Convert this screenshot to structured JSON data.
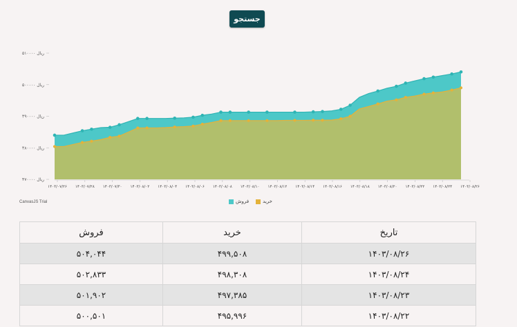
{
  "toolbar": {
    "search_label": "جستجو"
  },
  "colors": {
    "sell": "#4dc8c8",
    "sell_line": "#2fb4b4",
    "buy": "#b1bf6c",
    "buy_line": "#e4b23a"
  },
  "chart_data": {
    "type": "area",
    "title": "",
    "xlabel": "",
    "ylabel": "",
    "ylim": [
      470000,
      510000
    ],
    "yticks": [
      470000,
      480000,
      490000,
      500000,
      510000
    ],
    "ytick_labels": [
      "۴۷۰۰۰۰ ریال",
      "۴۸۰۰۰۰ ریال",
      "۴۹۰۰۰۰ ریال",
      "۵۰۰۰۰۰ ریال",
      "۵۱۰۰۰۰ ریال"
    ],
    "x_tick_labels": [
      "۱۴۰۳/۰۷/۲۶",
      "۱۴۰۳/۰۷/۲۸",
      "۱۴۰۳/۰۷/۳۰",
      "۱۴۰۳/۰۸/۰۲",
      "۱۴۰۳/۰۸/۰۴",
      "۱۴۰۳/۰۸/۰۶",
      "۱۴۰۳/۰۸/۰۸",
      "۱۴۰۳/۰۸/۱۰",
      "۱۴۰۳/۰۸/۱۲",
      "۱۴۰۳/۰۸/۱۴",
      "۱۴۰۳/۰۸/۱۶",
      "۱۴۰۳/۰۸/۱۸",
      "۱۴۰۳/۰۸/۲۰",
      "۱۴۰۳/۰۸/۲۲",
      "۱۴۰۳/۰۸/۲۴",
      "۱۴۰۳/۰۸/۲۶"
    ],
    "x": [
      "۱۴۰۳/۰۷/۲۶",
      "۱۴۰۳/۰۷/۲۷",
      "۱۴۰۳/۰۷/۲۸",
      "۱۴۰۳/۰۷/۲۹",
      "۱۴۰۳/۰۷/۳۰",
      "۱۴۰۳/۰۸/۰۱",
      "۱۴۰۳/۰۸/۰۲",
      "۱۴۰۳/۰۸/۰۳",
      "۱۴۰۳/۰۸/۰۴",
      "۱۴۰۳/۰۸/۰۵",
      "۱۴۰۳/۰۸/۰۶",
      "۱۴۰۳/۰۸/۰۷",
      "۱۴۰۳/۰۸/۰۸",
      "۱۴۰۳/۰۸/۰۹",
      "۱۴۰۳/۰۸/۱۰",
      "۱۴۰۳/۰۸/۱۱",
      "۱۴۰۳/۰۸/۱۲",
      "۱۴۰۳/۰۸/۱۳",
      "۱۴۰۳/۰۸/۱۴",
      "۱۴۰۳/۰۸/۱۵",
      "۱۴۰۳/۰۸/۱۶",
      "۱۴۰۳/۰۸/۱۷",
      "۱۴۰۳/۰۸/۱۸",
      "۱۴۰۳/۰۸/۱۹",
      "۱۴۰۳/۰۸/۲۰",
      "۱۴۰۳/۰۸/۲۱",
      "۱۴۰۳/۰۸/۲۲",
      "۱۴۰۳/۰۸/۲۳",
      "۱۴۰۳/۰۸/۲۴",
      "۱۴۰۳/۰۸/۲۵",
      "۱۴۰۳/۰۸/۲۶"
    ],
    "x_marker_indices": [
      0,
      2,
      3,
      4,
      5,
      6,
      7,
      9,
      10,
      11,
      12,
      13,
      14,
      16,
      18,
      19,
      20,
      21,
      22,
      24,
      25,
      26,
      27,
      28,
      29,
      30
    ],
    "legend_position": "bottom-center",
    "grid": false,
    "series": [
      {
        "name": "خرید",
        "values": [
          480400,
          480400,
          481050,
          481700,
          482100,
          482600,
          483300,
          483700,
          485000,
          486300,
          486300,
          486300,
          486400,
          486600,
          486700,
          486900,
          487500,
          488000,
          488600,
          488600,
          488600,
          488600,
          488600,
          488600,
          488600,
          488700,
          488700,
          488700,
          488750,
          488750,
          488800,
          489200,
          490000,
          492300,
          493100,
          493900,
          494800,
          495200,
          496000,
          496400,
          497000,
          497400,
          497700,
          498300,
          499000
        ]
      },
      {
        "name": "فروش",
        "values": [
          484000,
          484000,
          484700,
          485400,
          485900,
          486400,
          486500,
          487300,
          488300,
          489300,
          489300,
          489300,
          489300,
          489400,
          489500,
          489700,
          490300,
          490700,
          491300,
          491300,
          491300,
          491300,
          491300,
          491300,
          491300,
          491300,
          491300,
          491300,
          491400,
          491500,
          491700,
          492200,
          493500,
          496000,
          497200,
          498000,
          498900,
          499500,
          500500,
          501200,
          501900,
          502400,
          502900,
          503400,
          504044
        ]
      }
    ]
  },
  "table": {
    "headers": {
      "date": "تاریخ",
      "buy": "خرید",
      "sell": "فروش"
    },
    "rows": [
      {
        "date": "۱۴۰۳/۰۸/۲۶",
        "buy": "۴۹۹,۵۰۸",
        "sell": "۵۰۴,۰۴۴"
      },
      {
        "date": "۱۴۰۳/۰۸/۲۴",
        "buy": "۴۹۸,۳۰۸",
        "sell": "۵۰۲,۸۳۳"
      },
      {
        "date": "۱۴۰۳/۰۸/۲۳",
        "buy": "۴۹۷,۳۸۵",
        "sell": "۵۰۱,۹۰۲"
      },
      {
        "date": "۱۴۰۳/۰۸/۲۲",
        "buy": "۴۹۵,۹۹۶",
        "sell": "۵۰۰,۵۰۱"
      }
    ]
  },
  "legend": {
    "buy_label": "خرید",
    "sell_label": "فروش"
  },
  "watermark": "CanvasJS Trial"
}
